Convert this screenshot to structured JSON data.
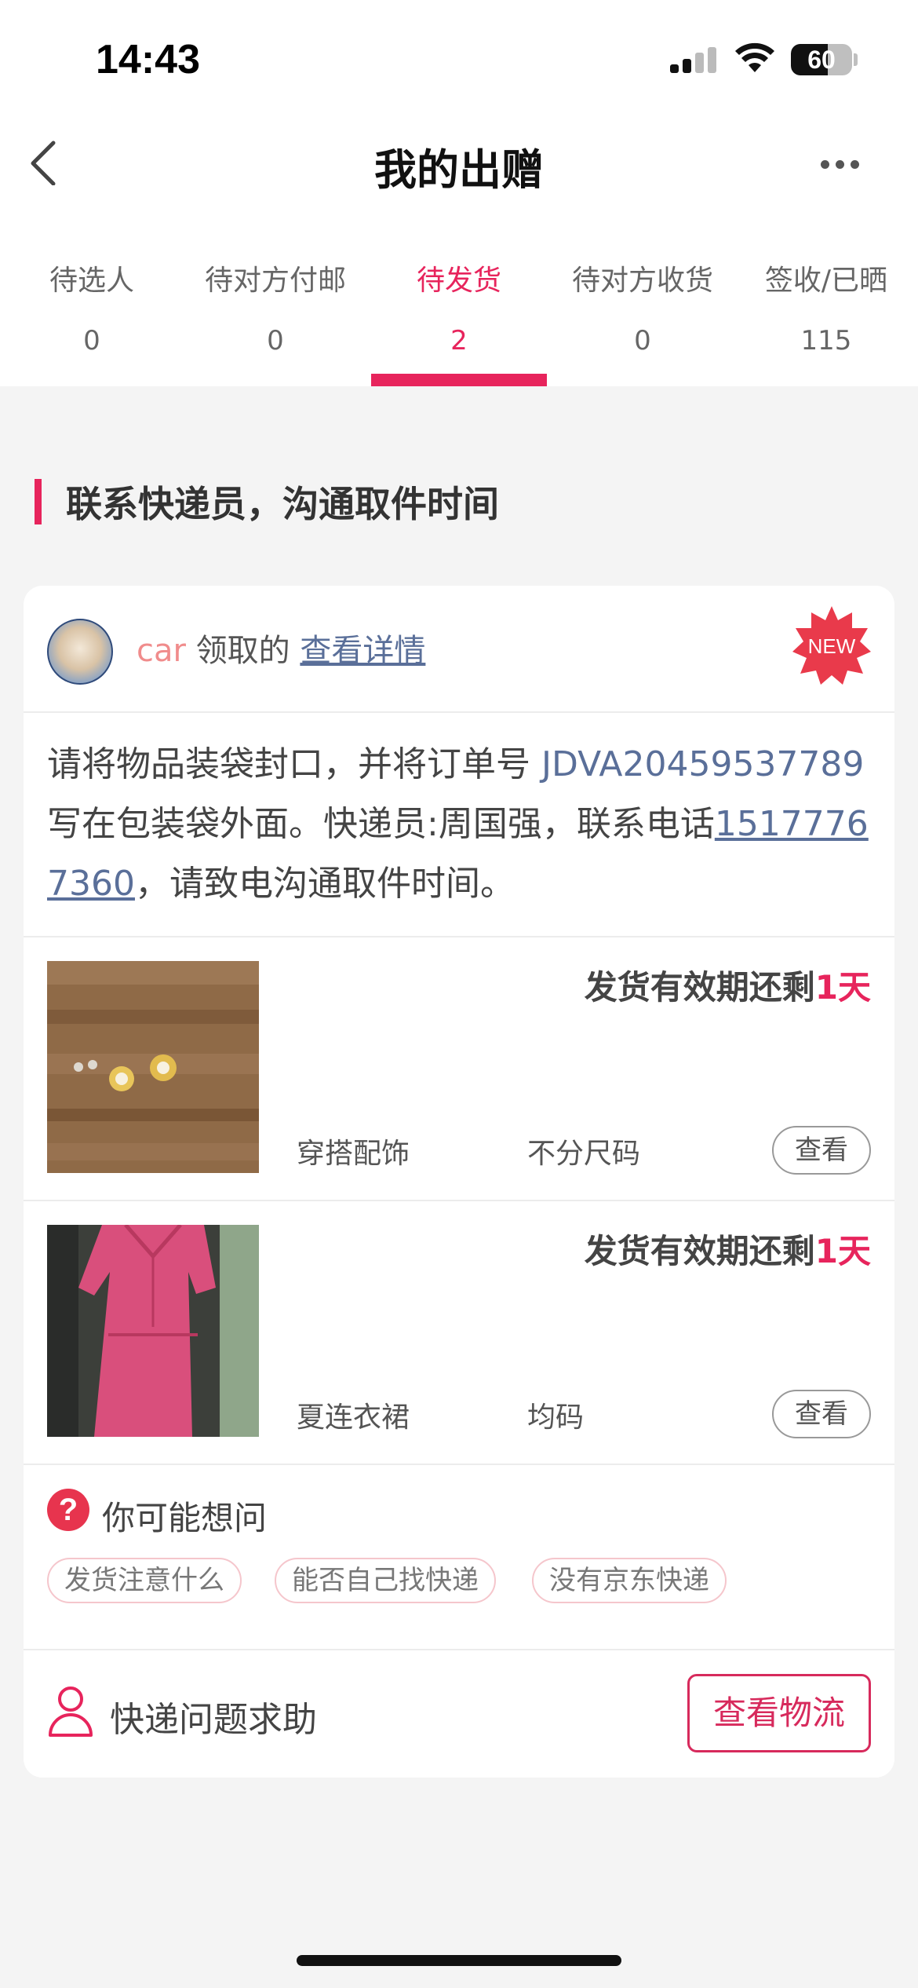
{
  "status_bar": {
    "time": "14:43",
    "battery": "60",
    "battery_level": 0.6
  },
  "header": {
    "title": "我的出赠"
  },
  "tabs": [
    {
      "label": "待选人",
      "count": "0"
    },
    {
      "label": "待对方付邮",
      "count": "0"
    },
    {
      "label": "待发货",
      "count": "2",
      "active": true
    },
    {
      "label": "待对方收货",
      "count": "0"
    },
    {
      "label": "签收/已晒",
      "count": "115"
    }
  ],
  "section": {
    "title": "联系快递员，沟通取件时间"
  },
  "card": {
    "receiver": {
      "name": "car",
      "action": "领取的",
      "link": "查看详情",
      "badge": "NEW"
    },
    "instruction": {
      "part1": "请将物品装袋封口，并将订单号 ",
      "order_no": "JDVA20459537789",
      "part2": " 写在包装袋外面。快递员:周国强，联系电话",
      "phone": "15177767360",
      "part3": "，请致电沟通取件时间。"
    },
    "items": [
      {
        "deadline_prefix": "发货有效期还剩",
        "deadline_value": "1天",
        "category": "穿搭配饰",
        "size": "不分尺码",
        "view_label": "查看"
      },
      {
        "deadline_prefix": "发货有效期还剩",
        "deadline_value": "1天",
        "category": "夏连衣裙",
        "size": "均码",
        "view_label": "查看"
      }
    ],
    "faq": {
      "icon": "?",
      "title": "你可能想问",
      "chips": [
        "发货注意什么",
        "能否自己找快递",
        "没有京东快递"
      ]
    },
    "help": {
      "label": "快递问题求助",
      "button": "查看物流"
    }
  },
  "colors": {
    "accent": "#e7245c",
    "link": "#5a6f99",
    "background": "#f4f4f4"
  }
}
